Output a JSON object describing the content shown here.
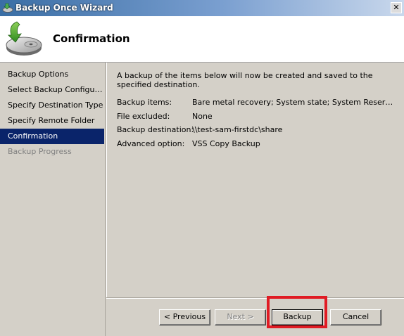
{
  "window": {
    "title": "Backup Once Wizard",
    "close_glyph": "✕",
    "icon": "backup-wizard-icon"
  },
  "header": {
    "title": "Confirmation",
    "icon": "backup-disk-arrow-icon"
  },
  "sidebar": {
    "items": [
      {
        "label": "Backup Options",
        "state": "normal"
      },
      {
        "label": "Select Backup Configur...",
        "state": "normal"
      },
      {
        "label": "Specify Destination Type",
        "state": "normal"
      },
      {
        "label": "Specify Remote Folder",
        "state": "normal"
      },
      {
        "label": "Confirmation",
        "state": "active"
      },
      {
        "label": "Backup Progress",
        "state": "disabled"
      }
    ],
    "active_color": "#0a246a"
  },
  "content": {
    "intro": "A backup of the items below will now be created and saved to the specified destination.",
    "rows": [
      {
        "label": "Backup items:",
        "value": "Bare metal recovery; System state; System Reserved; L..."
      },
      {
        "label": "File excluded:",
        "value": "None"
      },
      {
        "label": "Backup destination:",
        "value": "\\\\test-sam-firstdc\\share"
      },
      {
        "label": "Advanced option:",
        "value": "VSS Copy Backup"
      }
    ]
  },
  "buttons": {
    "previous": "< Previous",
    "next": "Next >",
    "backup": "Backup",
    "cancel": "Cancel"
  },
  "annotation": {
    "highlight_color": "#e01b24",
    "target": "backup-button"
  }
}
